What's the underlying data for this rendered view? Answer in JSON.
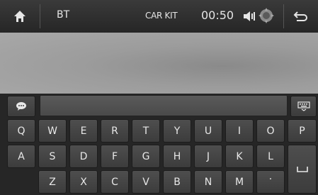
{
  "topbar": {
    "bt_label": "BT",
    "title": "CAR KIT",
    "time": "00:50",
    "icons": [
      "home-icon",
      "speaker-icon",
      "gear-icon",
      "back-arrow-icon"
    ]
  },
  "keyboard": {
    "input_value": "",
    "row1": [
      "Q",
      "W",
      "E",
      "R",
      "T",
      "Y",
      "U",
      "I",
      "O",
      "P"
    ],
    "row2": [
      "A",
      "S",
      "D",
      "F",
      "G",
      "H",
      "J",
      "K",
      "L"
    ],
    "row3": [
      "Z",
      "X",
      "C",
      "V",
      "B",
      "N",
      "M",
      "·"
    ],
    "icons": [
      "chat-bubble-icon",
      "keyboard-icon",
      "enter-icon"
    ]
  }
}
